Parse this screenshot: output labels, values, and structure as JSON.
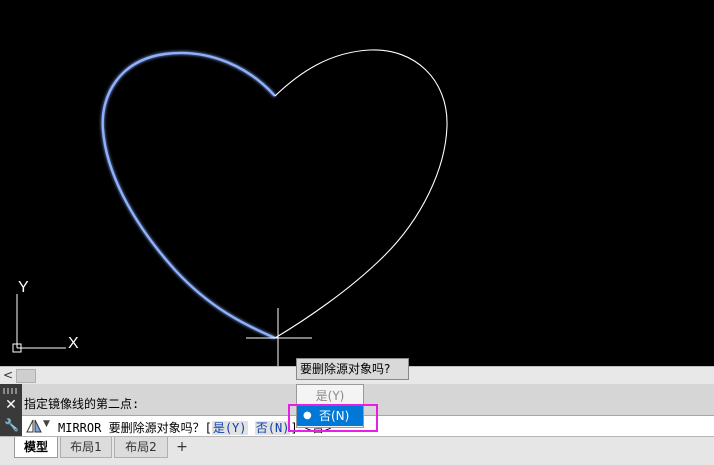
{
  "canvas": {
    "ucs_labels": {
      "y": "Y",
      "x": "X"
    }
  },
  "command": {
    "history": "指定镜像线的第二点:",
    "prefix": "MIRROR 要删除源对象吗？[",
    "opt_yes": "是(",
    "opt_yes_key": "Y",
    "opt_yes_end": ")",
    "opt_no": "否(",
    "opt_no_key": "N",
    "opt_no_end": ")",
    "suffix": "] <否>:"
  },
  "tooltip": {
    "text": "要删除源对象吗?"
  },
  "dropdown": {
    "options": [
      "是(Y)",
      "否(N)"
    ],
    "selected": "否(N)"
  },
  "tabs": [
    "模型",
    "布局1",
    "布局2"
  ],
  "add_tab_label": "+",
  "scroll": {
    "left_arrow": "<"
  },
  "colors": {
    "canvas_bg": "#000000",
    "highlight_border": "#e81ee8",
    "menu_selected": "#0078d7",
    "heart_stroke_left": "#9ab8ff",
    "heart_stroke_right": "#ffffff"
  }
}
